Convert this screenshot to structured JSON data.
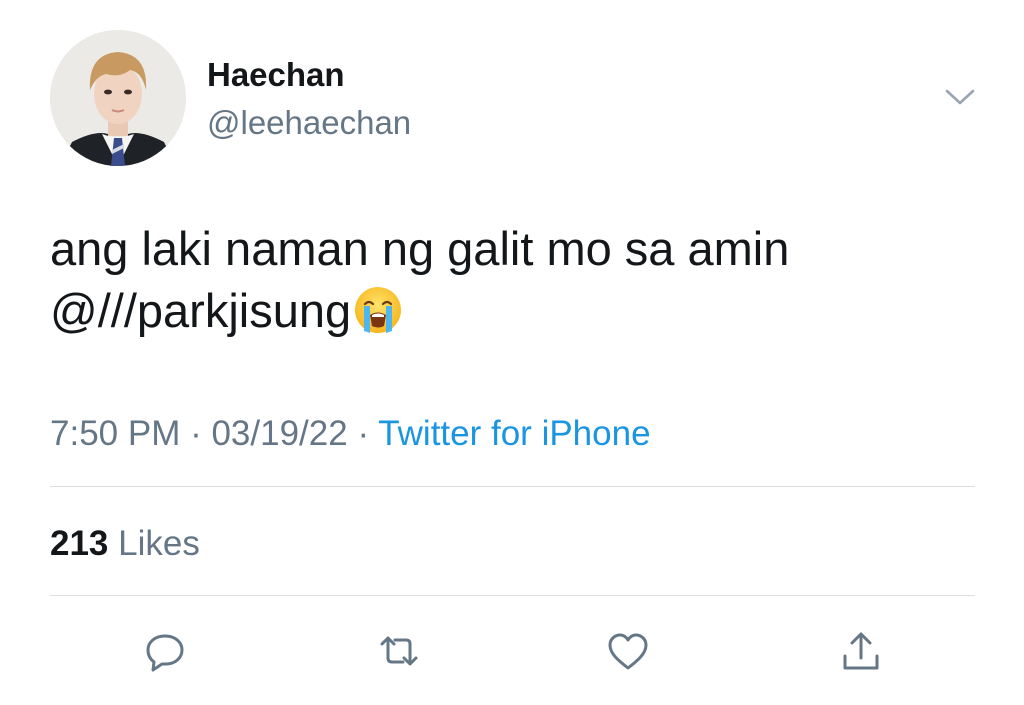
{
  "author": {
    "display_name": "Haechan",
    "handle": "@leehaechan"
  },
  "tweet": {
    "line1": "ang laki naman ng galit mo sa amin",
    "line2": "@///parkjisung",
    "emoji": "loudly-crying-face"
  },
  "meta": {
    "time": "7:50 PM",
    "separator": " · ",
    "date": "03/19/22",
    "source": "Twitter for iPhone"
  },
  "stats": {
    "likes_count": "213",
    "likes_label": "Likes"
  },
  "actions": {
    "icons": [
      "reply-icon",
      "retweet-icon",
      "like-icon",
      "share-icon"
    ]
  },
  "colors": {
    "text": "#14171a",
    "secondary": "#657786",
    "link": "#1b95e0",
    "divider": "#dcdfe2",
    "icon": "#657786"
  }
}
